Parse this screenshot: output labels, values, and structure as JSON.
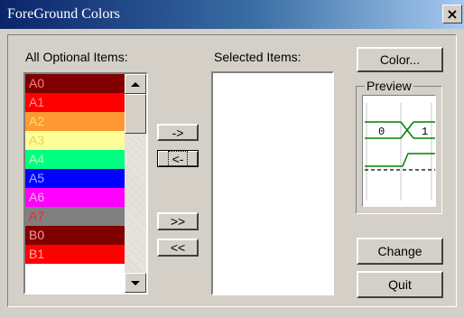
{
  "window": {
    "title": "ForeGround Colors",
    "close_glyph": "×"
  },
  "labels": {
    "optional": "All Optional Items:",
    "selected": "Selected Items:",
    "preview": "Preview"
  },
  "optional_items": [
    {
      "label": "A0",
      "bg": "#800000",
      "fg": "#ff8080"
    },
    {
      "label": "A1",
      "bg": "#ff0000",
      "fg": "#ff9999"
    },
    {
      "label": "A2",
      "bg": "#ff9933",
      "fg": "#ffe070"
    },
    {
      "label": "A3",
      "bg": "#ffff99",
      "fg": "#e8d050"
    },
    {
      "label": "A4",
      "bg": "#00ff80",
      "fg": "#c0ffc0"
    },
    {
      "label": "A5",
      "bg": "#0000ff",
      "fg": "#9db8ff"
    },
    {
      "label": "A6",
      "bg": "#ff00ff",
      "fg": "#ffb0ff"
    },
    {
      "label": "A7",
      "bg": "#808080",
      "fg": "#ff2020"
    },
    {
      "label": "B0",
      "bg": "#800000",
      "fg": "#ff9999"
    },
    {
      "label": "B1",
      "bg": "#ff0000",
      "fg": "#ffb0b0"
    }
  ],
  "selected_items": [],
  "buttons": {
    "add": "->",
    "remove": "<-",
    "add_all": ">>",
    "remove_all": "<<",
    "color": "Color...",
    "change": "Change",
    "quit": "Quit"
  },
  "preview": {
    "bus_value_left": "0",
    "bus_value_right": "1",
    "wave_color": "#008000"
  },
  "icons": {
    "close": "close-icon",
    "scroll_up": "scroll-up-arrow-icon",
    "scroll_down": "scroll-down-arrow-icon"
  }
}
